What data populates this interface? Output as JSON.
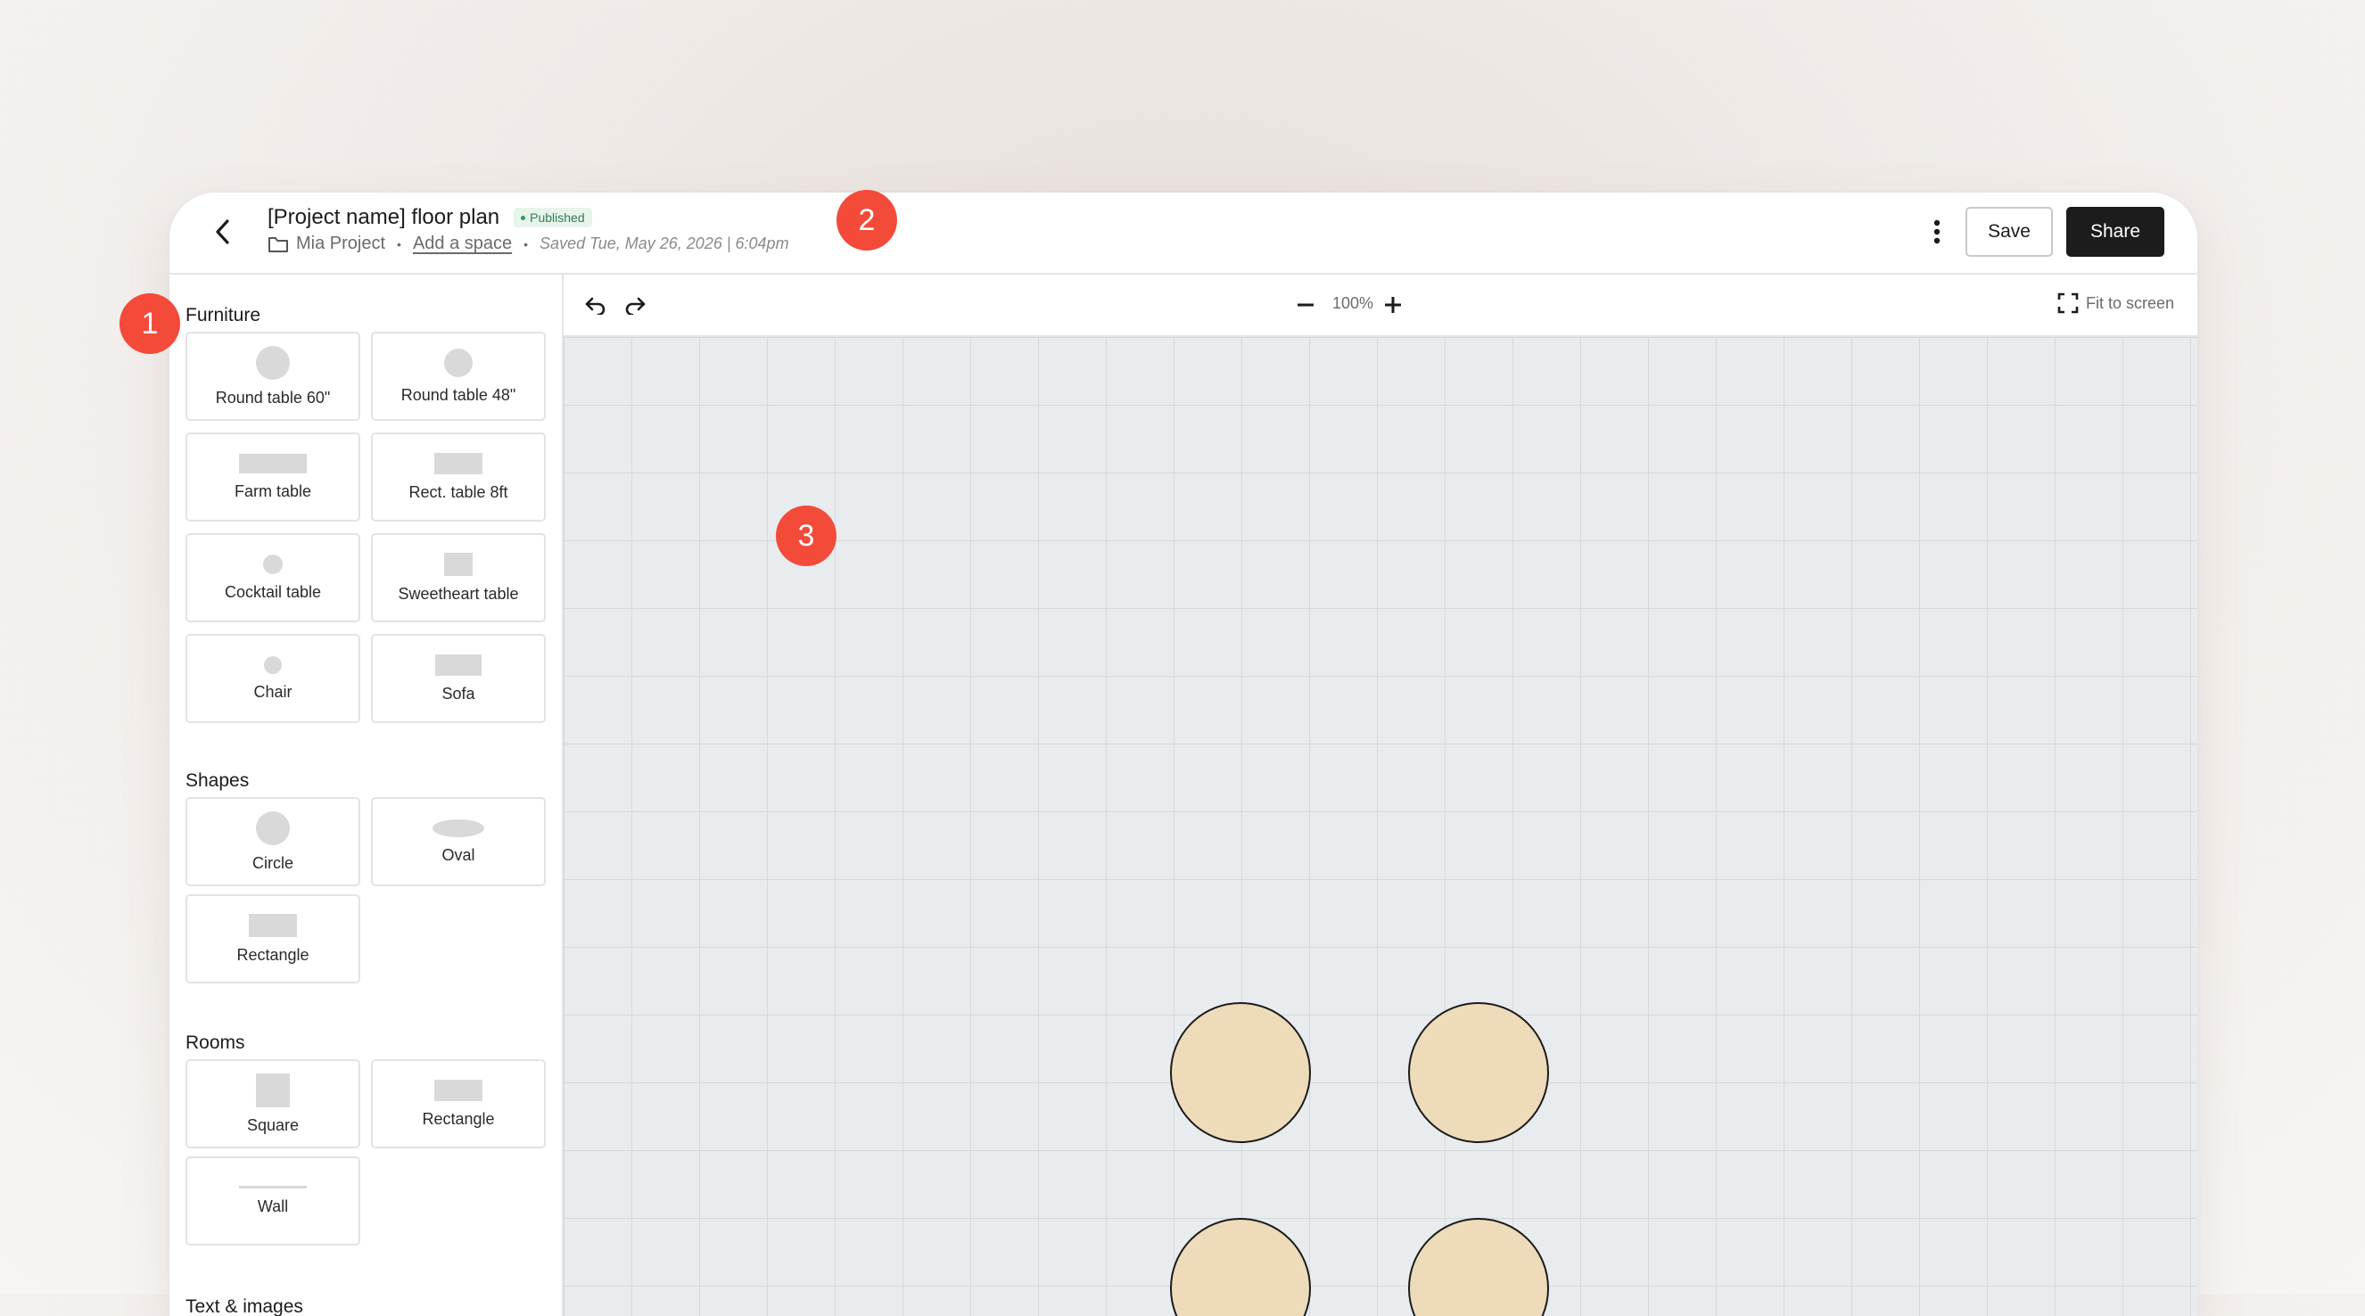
{
  "header": {
    "title": "[Project name] floor plan",
    "status_badge": "Published",
    "project_name": "Mia Project",
    "add_space_label": "Add a space",
    "saved_text": "Saved Tue, May 26, 2026 | 6:04pm",
    "save_label": "Save",
    "share_label": "Share"
  },
  "sidebar": {
    "furniture_title": "Furniture",
    "furniture": [
      {
        "label": "Round table 60\"",
        "icon": "round-table-60-icon"
      },
      {
        "label": "Round table 48\"",
        "icon": "round-table-48-icon"
      },
      {
        "label": "Farm table",
        "icon": "farm-table-icon"
      },
      {
        "label": "Rect. table 8ft",
        "icon": "rect-table-icon"
      },
      {
        "label": "Cocktail table",
        "icon": "cocktail-table-icon"
      },
      {
        "label": "Sweetheart table",
        "icon": "sweetheart-table-icon"
      },
      {
        "label": "Chair",
        "icon": "chair-icon"
      },
      {
        "label": "Sofa",
        "icon": "sofa-icon"
      }
    ],
    "shapes_title": "Shapes",
    "shapes": [
      {
        "label": "Circle",
        "icon": "circle-icon"
      },
      {
        "label": "Oval",
        "icon": "oval-icon"
      },
      {
        "label": "Rectangle",
        "icon": "rectangle-icon"
      }
    ],
    "rooms_title": "Rooms",
    "rooms": [
      {
        "label": "Square",
        "icon": "square-room-icon"
      },
      {
        "label": "Rectangle",
        "icon": "rectangle-room-icon"
      },
      {
        "label": "Wall",
        "icon": "wall-icon"
      }
    ],
    "text_images_title": "Text & images"
  },
  "toolbar": {
    "zoom_level": "100%",
    "fit_label": "Fit to screen"
  },
  "canvas": {
    "items": [
      {
        "type": "round-table"
      },
      {
        "type": "round-table"
      },
      {
        "type": "round-table"
      },
      {
        "type": "round-table"
      }
    ]
  },
  "markers": [
    "1",
    "2",
    "3"
  ],
  "colors": {
    "accent_marker": "#f44a3a",
    "published_badge_bg": "#e7f4ec",
    "published_badge_text": "#2f7d4f",
    "share_button_bg": "#1c1c1c",
    "table_fill": "#eddbb9",
    "canvas_bg": "#e9ecef"
  }
}
